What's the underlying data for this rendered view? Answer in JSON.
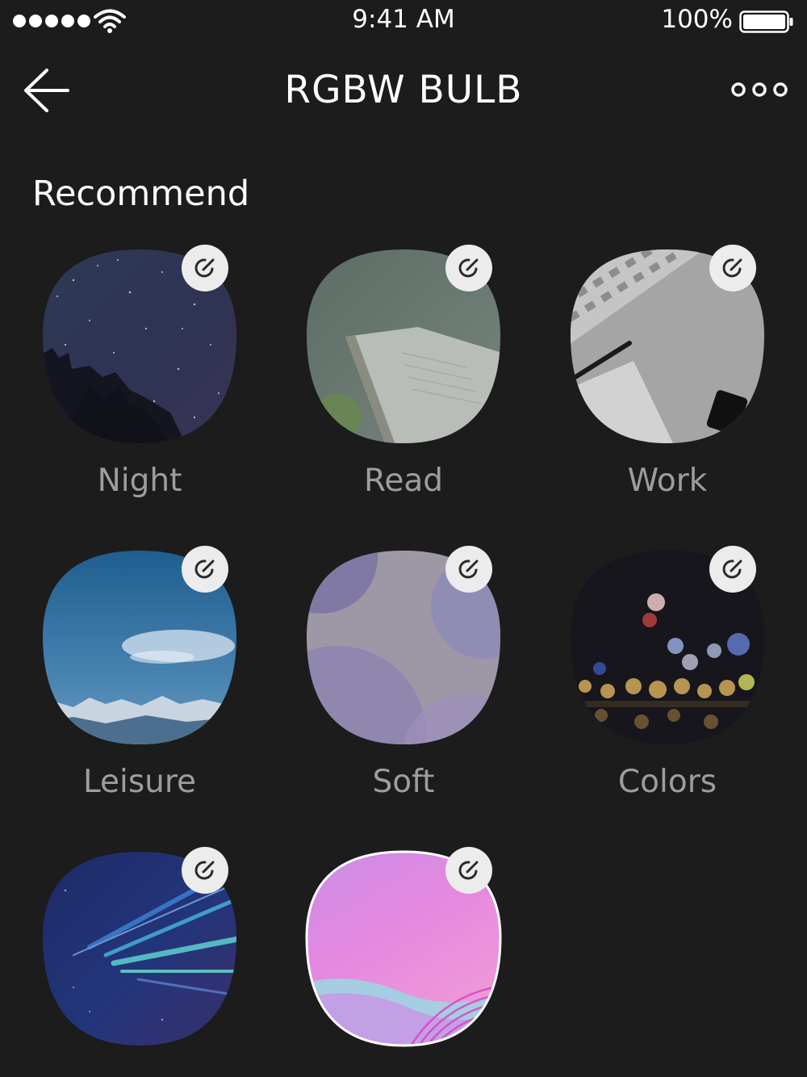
{
  "status_bar": {
    "time": "9:41 AM",
    "battery_percent": "100%",
    "battery_level": 1.0,
    "signal_icon": "signal-dots-icon",
    "wifi_icon": "wifi-icon"
  },
  "nav": {
    "title": "RGBW BULB",
    "back_icon": "back-arrow-icon",
    "more_icon": "more-icon"
  },
  "section": {
    "title": "Recommend"
  },
  "scenes": [
    {
      "label": "Night"
    },
    {
      "label": "Read"
    },
    {
      "label": "Work"
    },
    {
      "label": "Leisure"
    },
    {
      "label": "Soft"
    },
    {
      "label": "Colors"
    },
    {
      "label": ""
    },
    {
      "label": ""
    }
  ],
  "colors": {
    "background": "#1c1c1c",
    "label": "#9d9d9d",
    "edit_button": "#ececec"
  }
}
